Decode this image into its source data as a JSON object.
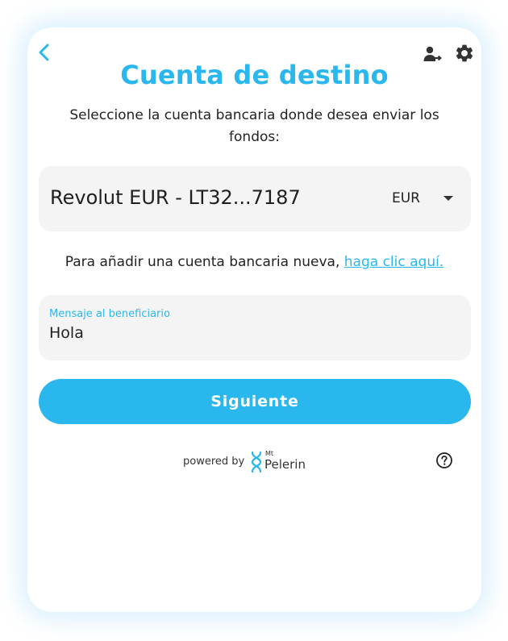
{
  "header": {
    "title": "Cuenta de destino",
    "back_icon": "chevron-left-icon",
    "account_icon": "account-switch-icon",
    "settings_icon": "gear-icon"
  },
  "form": {
    "subtitle": "Seleccione la cuenta bancaria donde desea enviar los fondos:",
    "account_select": {
      "value": "Revolut EUR - LT32...7187",
      "currency": "EUR"
    },
    "add_account_text": "Para añadir una cuenta bancaria nueva,",
    "add_account_link": "haga clic aquí.",
    "message": {
      "label": "Mensaje al beneficiario",
      "value": "Hola"
    },
    "next_label": "Siguiente"
  },
  "footer": {
    "powered_by": "powered by",
    "brand_small": "Mt",
    "brand_name": "Pelerin",
    "help_icon": "help-circle-icon"
  },
  "colors": {
    "accent": "#2ab7ee",
    "field_bg": "#f4f4f4",
    "text": "#222222"
  }
}
